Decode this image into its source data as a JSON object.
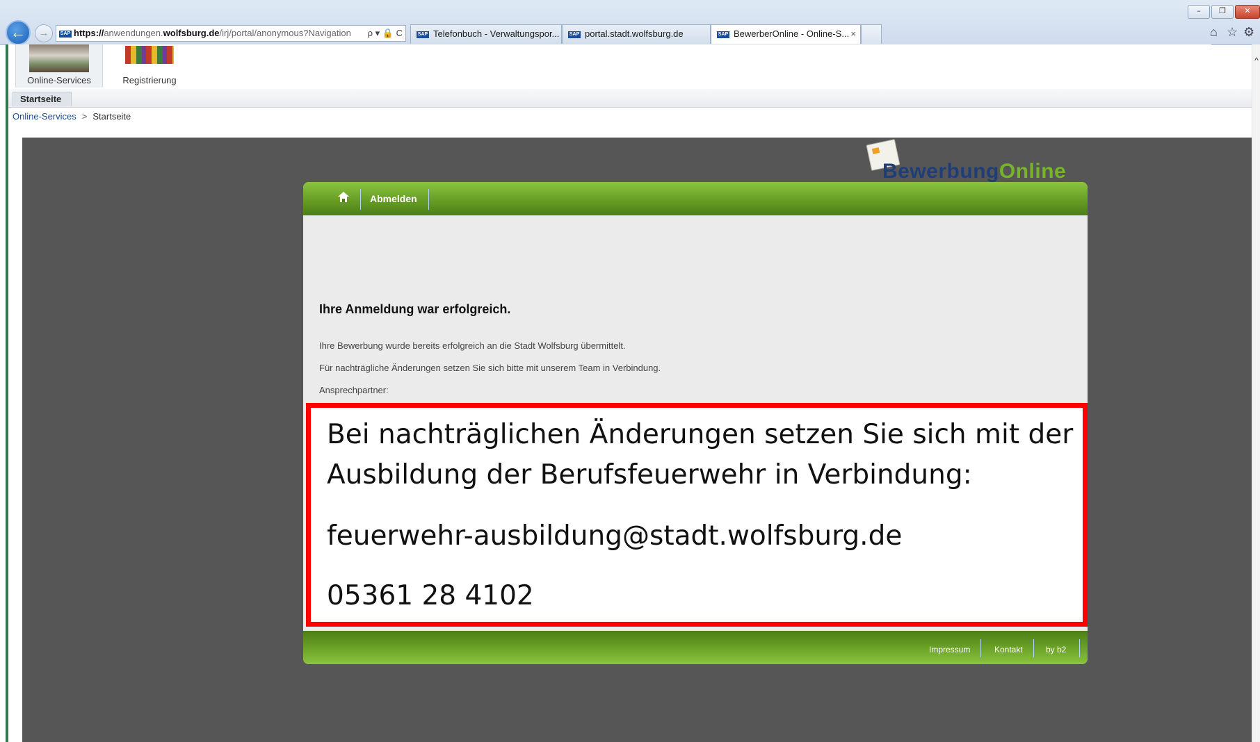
{
  "browser": {
    "address": {
      "scheme": "https://",
      "host_pre": "anwendungen.",
      "host_main": "wolfsburg.de",
      "path": "/irj/portal/anonymous?Navigation",
      "tools": "ρ ▾ 🔒 C"
    },
    "tabs": [
      {
        "label": "Telefonbuch - Verwaltungspor...",
        "active": false
      },
      {
        "label": "portal.stadt.wolfsburg.de",
        "active": false
      },
      {
        "label": "BewerberOnline - Online-S...",
        "active": true,
        "close": "×"
      }
    ],
    "favicon_text": "SAP",
    "back_glyph": "←",
    "forward_glyph": "→",
    "home_glyph": "⌂",
    "favorites_glyph": "☆",
    "settings_glyph": "⚙",
    "window_buttons": {
      "minimize": "–",
      "restore": "❐",
      "close": "✕"
    }
  },
  "portal": {
    "top_items": [
      {
        "label": "Online-Services",
        "icon": "building-photo-icon"
      },
      {
        "label": "Registrierung",
        "icon": "people-figures-icon"
      }
    ],
    "nav_tab": "Startseite",
    "breadcrumb": {
      "first": "Online-Services",
      "separator": ">",
      "current": "Startseite"
    },
    "scroll_up": "^"
  },
  "app": {
    "logo": {
      "part1": "Bewerbung",
      "part2": "Online"
    },
    "header": {
      "logout_label": "Abmelden"
    },
    "success_heading": "Ihre Anmeldung war erfolgreich.",
    "paragraphs": [
      "Ihre Bewerbung wurde bereits erfolgreich an die Stadt Wolfsburg übermittelt.",
      "Für nachträgliche Änderungen setzen Sie sich bitte mit unserem Team in Verbindung.",
      "Ansprechpartner:"
    ],
    "footer": {
      "impressum": "Impressum",
      "kontakt": "Kontakt",
      "by": "by b2"
    }
  },
  "notice": {
    "line1": "Bei nachträglichen Änderungen setzen Sie sich mit der",
    "line2": "Ausbildung der Berufsfeuerwehr in Verbindung:",
    "email": "feuerwehr-ausbildung@stadt.wolfsburg.de",
    "phone": "05361 28 4102"
  },
  "colors": {
    "green_header": "#6aa127",
    "logo_blue": "#1f3e78",
    "logo_green": "#78b42a",
    "app_background": "#565656",
    "notice_border": "#ff0000"
  }
}
